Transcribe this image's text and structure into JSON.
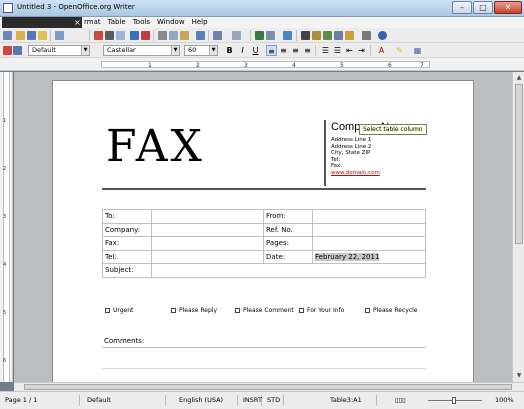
{
  "window": {
    "title": "Untitled 3 - OpenOffice.org Writer"
  },
  "menu": {
    "popup_fragment": "",
    "items": [
      "rmat",
      "Table",
      "Tools",
      "Window",
      "Help"
    ]
  },
  "formatting": {
    "style": "Default",
    "font": "Castellar",
    "size": "60",
    "bold": "B",
    "italic": "I",
    "underline": "U"
  },
  "ruler": {
    "numbers": [
      "1",
      "2",
      "3",
      "4",
      "5",
      "6",
      "7"
    ]
  },
  "vruler": {
    "numbers": [
      "1",
      "2",
      "3",
      "4",
      "5",
      "6"
    ]
  },
  "document": {
    "heading": "FAX",
    "company": {
      "name": "Company Name",
      "lines": [
        "Address Line 1",
        "Address Line 2",
        "City, State ZIP",
        "Tel:",
        "Fax:"
      ],
      "link": "www.domain.com"
    },
    "tooltip": "Select table column",
    "fields": {
      "to": "To:",
      "from": "From:",
      "company": "Company:",
      "ref": "Ref. No.",
      "fax": "Fax:",
      "pages": "Pages:",
      "tel": "Tel:",
      "date": "Date:",
      "date_value": "February 22, 2011",
      "subject": "Subject:"
    },
    "checkboxes": [
      "Urgent",
      "Please Reply",
      "Please Comment",
      "For Your Info",
      "Please Recycle"
    ],
    "comments": "Comments:"
  },
  "status": {
    "page": "Page 1 / 1",
    "style": "Default",
    "language": "English (USA)",
    "insert": "INSRT",
    "std": "STD",
    "table": "Table3:A1",
    "zoom": "100%"
  }
}
